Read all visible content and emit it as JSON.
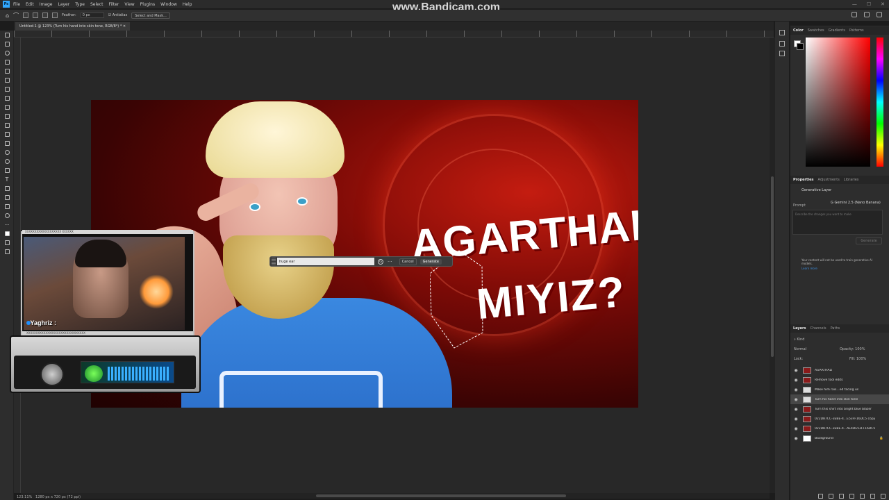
{
  "app": {
    "logo": "Ps",
    "watermark": "www.Bandicam.com"
  },
  "menu": [
    "File",
    "Edit",
    "Image",
    "Layer",
    "Type",
    "Select",
    "Filter",
    "View",
    "Plugins",
    "Window",
    "Help"
  ],
  "options_bar": {
    "feather_label": "Feather:",
    "feather_value": "0 px",
    "antialias_label": "Antialias",
    "select_mask_label": "Select and Mask..."
  },
  "document": {
    "tab_title": "Untitled-1 @ 123% (Turn his hand into skin tone, RGB/8*) *",
    "zoom": "123.11%",
    "dims": "1280 px x 720 px (72 ppi)"
  },
  "artwork": {
    "headline_line1": "AGARTHALI",
    "headline_line2": "MIYIZ?"
  },
  "prompt_bar": {
    "input_value": "huge ear",
    "cancel_label": "Cancel",
    "generate_label": "Generate",
    "more_label": "···"
  },
  "webcam": {
    "username": "Yaghriz :",
    "header_text": "XXXXXXXXXXXXXXXXXXX XXXXXX",
    "strip_text": "XXXXXXXXXXXXXXXXXXXXXXXXXXXXXXX"
  },
  "panels": {
    "color_tabs": [
      "Color",
      "Swatches",
      "Gradients",
      "Patterns"
    ],
    "properties_tabs": [
      "Properties",
      "Adjustments",
      "Libraries"
    ],
    "properties": {
      "layer_type": "Generative Layer",
      "prompt_label": "Prompt",
      "model": "Gemini 2.5 (Nano Banana)",
      "placeholder": "Describe the changes you want to make",
      "generate_btn": "Generate",
      "note": "Your content will not be used to train generative AI models.",
      "learn_more": "Learn more"
    },
    "layers_tabs": [
      "Layers",
      "Channels",
      "Paths"
    ],
    "layers_controls": {
      "kind": "Kind",
      "blend": "Normal",
      "opacity_label": "Opacity:",
      "opacity": "100%",
      "lock_label": "Lock:",
      "fill_label": "Fill:",
      "fill": "100%"
    },
    "layers": [
      {
        "name": "AGARTHALI",
        "thumb": "dark",
        "selected": false
      },
      {
        "name": "Remove tool edits",
        "thumb": "dark",
        "selected": false
      },
      {
        "name": "Make him rais...ed facing us",
        "thumb": "gen",
        "selected": false
      },
      {
        "name": "Turn his hand into skin tone",
        "thumb": "gen",
        "selected": true
      },
      {
        "name": "Turn this shirt into bright blue blazer",
        "thumb": "dark",
        "selected": false
      },
      {
        "name": "022D87CC-3EBE-4...E53FF16DC5 copy",
        "thumb": "dark",
        "selected": false
      },
      {
        "name": "022D87CC-3EBE-4...AE4DE53FF16DC5",
        "thumb": "dark",
        "selected": false
      },
      {
        "name": "Background",
        "thumb": "white",
        "selected": false
      }
    ]
  },
  "colors": {
    "accent": "#31a8ff",
    "panel_bg": "#2d2d2d",
    "canvas_bg": "#282828"
  }
}
